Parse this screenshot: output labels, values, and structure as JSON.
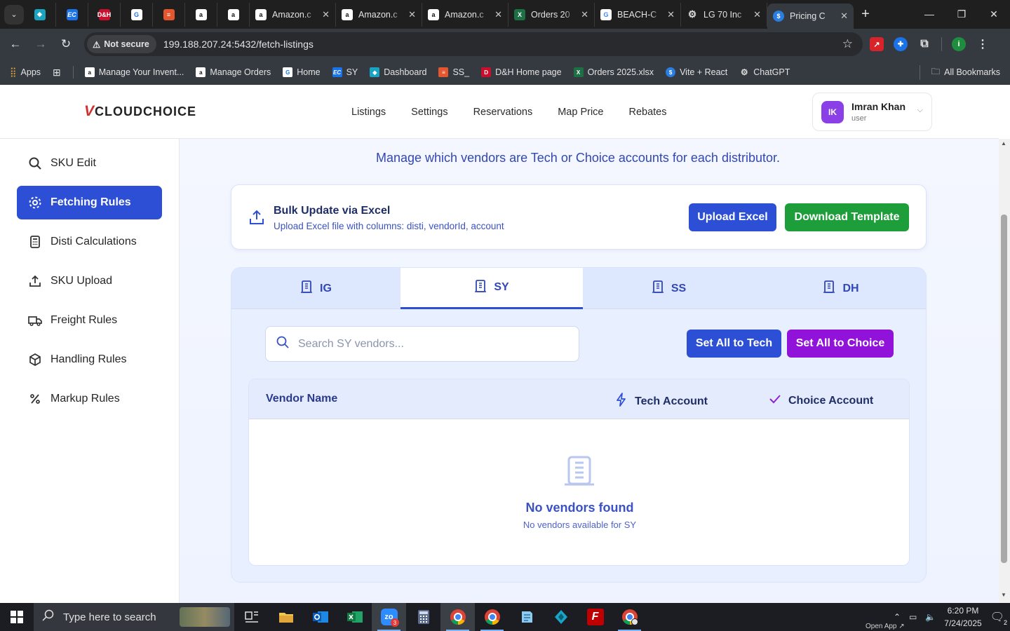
{
  "browser": {
    "tabs": [
      {
        "title": "Amazon.c",
        "icon": "amazon-icon"
      },
      {
        "title": "Amazon.c",
        "icon": "amazon-icon"
      },
      {
        "title": "Amazon.c",
        "icon": "amazon-icon"
      },
      {
        "title": "Orders 20",
        "icon": "excel-icon"
      },
      {
        "title": "BEACH-C",
        "icon": "google-icon"
      },
      {
        "title": "LG 70 Inc",
        "icon": "openai-icon"
      },
      {
        "title": "Pricing C",
        "icon": "dollar-icon"
      }
    ],
    "not_secure": "Not secure",
    "url": "199.188.207.24:5432/fetch-listings",
    "bookmarks": [
      {
        "label": "Apps"
      },
      {
        "label": "Manage Your Invent..."
      },
      {
        "label": "Manage Orders"
      },
      {
        "label": "Home"
      },
      {
        "label": "SY"
      },
      {
        "label": "Dashboard"
      },
      {
        "label": "SS_"
      },
      {
        "label": "D&H Home page"
      },
      {
        "label": "Orders 2025.xlsx"
      },
      {
        "label": "Vite + React"
      },
      {
        "label": "ChatGPT"
      }
    ],
    "all_bookmarks": "All Bookmarks"
  },
  "header": {
    "logo": "CLOUDCHOICE",
    "nav": [
      "Listings",
      "Settings",
      "Reservations",
      "Map Price",
      "Rebates"
    ],
    "user": {
      "initials": "IK",
      "name": "Imran Khan",
      "role": "user"
    }
  },
  "sidebar": {
    "items": [
      {
        "label": "SKU Edit",
        "icon": "search-icon"
      },
      {
        "label": "Fetching Rules",
        "icon": "gear-icon",
        "active": true
      },
      {
        "label": "Disti Calculations",
        "icon": "calculator-icon"
      },
      {
        "label": "SKU Upload",
        "icon": "upload-icon"
      },
      {
        "label": "Freight Rules",
        "icon": "truck-icon"
      },
      {
        "label": "Handling Rules",
        "icon": "box-icon"
      },
      {
        "label": "Markup Rules",
        "icon": "percent-icon"
      }
    ]
  },
  "main": {
    "subtitle": "Manage which vendors are Tech or Choice accounts for each distributor.",
    "bulk": {
      "title": "Bulk Update via Excel",
      "description": "Upload Excel file with columns: disti, vendorId, account",
      "upload_label": "Upload Excel",
      "template_label": "Download Template"
    },
    "tabs": [
      {
        "label": "IG"
      },
      {
        "label": "SY",
        "active": true
      },
      {
        "label": "SS"
      },
      {
        "label": "DH"
      }
    ],
    "search_placeholder": "Search SY vendors...",
    "set_tech_label": "Set All to Tech",
    "set_choice_label": "Set All to Choice",
    "table": {
      "col_vendor": "Vendor Name",
      "col_tech": "Tech Account",
      "col_choice": "Choice Account"
    },
    "empty": {
      "title": "No vendors found",
      "description": "No vendors available for SY"
    }
  },
  "taskbar": {
    "search_placeholder": "Type here to search",
    "time": "6:20 PM",
    "date": "7/24/2025",
    "open_app": "Open App ↗",
    "notification_count": "2"
  },
  "colors": {
    "accent": "#2d4fd6",
    "success": "#1e9e3a",
    "choice": "#9112d8"
  }
}
